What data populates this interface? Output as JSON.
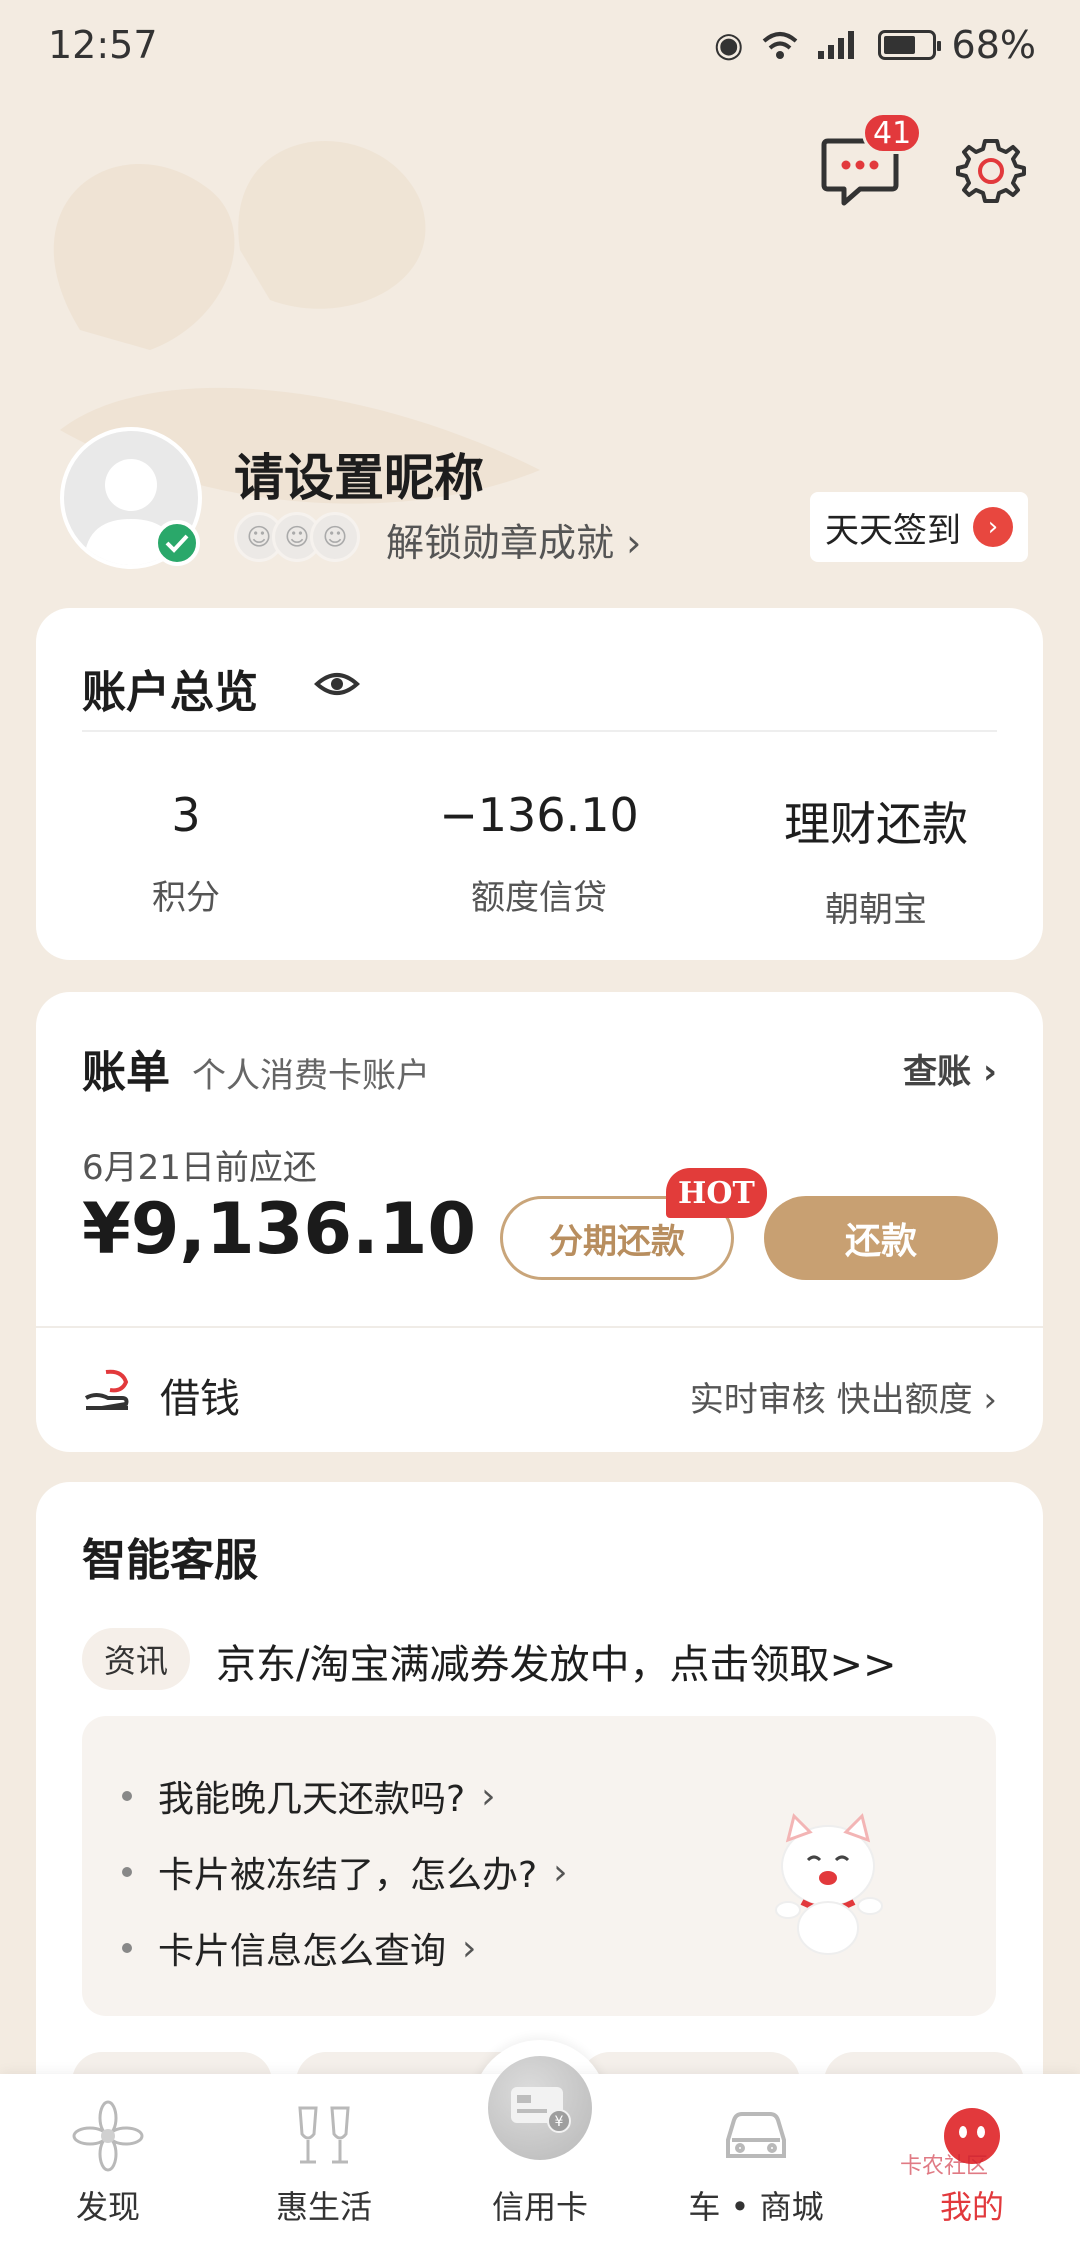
{
  "status_bar": {
    "time": "12:57",
    "battery": "68%",
    "battery_level": 0.68
  },
  "header": {
    "message_count": "41"
  },
  "profile": {
    "nickname": "请设置昵称",
    "unlock_badges_label": "解锁勋章成就 ›",
    "checkin_label": "天天签到"
  },
  "overview": {
    "title": "账户总览",
    "items": [
      {
        "value": "3",
        "label": "积分"
      },
      {
        "value": "−136.10",
        "label": "额度信贷"
      },
      {
        "value": "理财还款",
        "label": "朝朝宝"
      }
    ]
  },
  "bill": {
    "title": "账单",
    "subtitle": "个人消费卡账户",
    "check_label": "查账 ›",
    "due_label": "6月21日前应还",
    "due_amount": "¥9,136.10",
    "installment_label": "分期还款",
    "hot_tag": "HOT",
    "repay_label": "还款",
    "loan_label": "借钱",
    "loan_hint": "实时审核 快出额度 ›"
  },
  "assistant": {
    "title": "智能客服",
    "news_tag": "资讯",
    "news_text": "京东/淘宝满减券发放中，点击领取>>",
    "faqs": [
      {
        "text": "我能晚几天还款吗?"
      },
      {
        "text": "卡片被冻结了，怎么办?"
      },
      {
        "text": "卡片信息怎么查询"
      }
    ]
  },
  "nav": {
    "items": [
      {
        "label": "发现",
        "icon": "discover-icon"
      },
      {
        "label": "惠生活",
        "icon": "life-icon"
      },
      {
        "label": "信用卡",
        "icon": "credit-card-icon"
      },
      {
        "label": "车 • 商城",
        "icon": "car-icon"
      },
      {
        "label": "我的",
        "icon": "mine-icon"
      }
    ],
    "active_index": 4
  },
  "watermark": "卡农社区",
  "colors": {
    "accent": "#c8a072",
    "red": "#e2393c",
    "background": "#f3ebe1"
  }
}
